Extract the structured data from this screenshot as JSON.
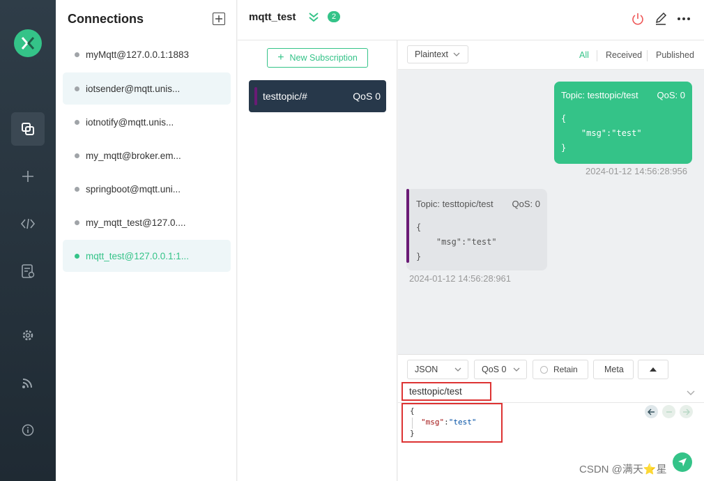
{
  "connections": {
    "title": "Connections",
    "items": [
      {
        "label": "myMqtt@127.0.0.1:1883"
      },
      {
        "label": "iotsender@mqtt.unis..."
      },
      {
        "label": "iotnotify@mqtt.unis..."
      },
      {
        "label": "my_mqtt@broker.em..."
      },
      {
        "label": "springboot@mqtt.uni..."
      },
      {
        "label": "my_mqtt_test@127.0...."
      },
      {
        "label": "mqtt_test@127.0.0.1:1..."
      }
    ]
  },
  "header": {
    "title": "mqtt_test",
    "badge": "2"
  },
  "subscriptions": {
    "new_label": "New Subscription",
    "items": [
      {
        "topic": "testtopic/#",
        "qos": "QoS 0"
      }
    ]
  },
  "message_bar": {
    "format": "Plaintext",
    "filters": [
      "All",
      "Received",
      "Published"
    ]
  },
  "messages": [
    {
      "direction": "out",
      "topic": "Topic: testtopic/test",
      "qos": "QoS: 0",
      "payload": "{\n    \"msg\":\"test\"\n}",
      "timestamp": "2024-01-12 14:56:28:956"
    },
    {
      "direction": "in",
      "topic": "Topic: testtopic/test",
      "qos": "QoS: 0",
      "payload": "{\n    \"msg\":\"test\"\n}",
      "timestamp": "2024-01-12 14:56:28:961"
    }
  ],
  "composer": {
    "format": "JSON",
    "qos": "QoS 0",
    "retain": "Retain",
    "meta": "Meta",
    "topic": "testtopic/test",
    "code_open": "{",
    "code_key": "\"msg\"",
    "code_colon": ":",
    "code_value": "\"test\"",
    "code_close": "}"
  },
  "watermark": "CSDN @满天⭐星",
  "colors": {
    "accent": "#34c388",
    "rail": "#2f3d48",
    "sub_bg": "#27384a",
    "sub_bar": "#6a1b75",
    "highlight": "#d33"
  }
}
